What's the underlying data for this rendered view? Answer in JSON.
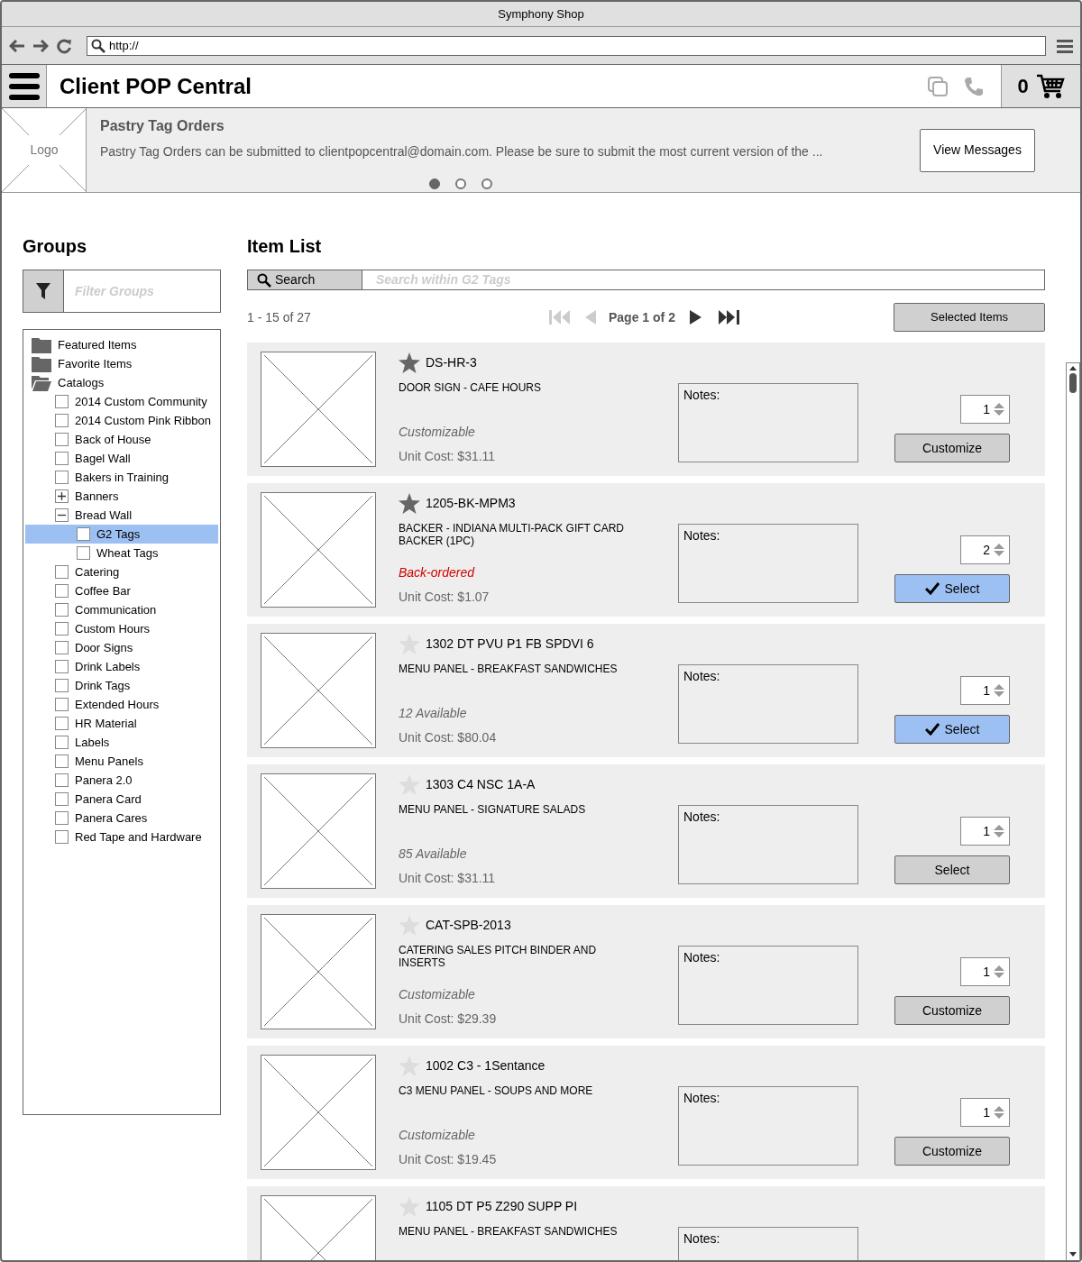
{
  "window": {
    "title": "Symphony Shop"
  },
  "browser": {
    "address": "http://"
  },
  "header": {
    "title": "Client POP Central",
    "cart_count": "0"
  },
  "banner": {
    "logo": "Logo",
    "title": "Pastry Tag Orders",
    "message": "Pastry Tag Orders can be submitted to clientpopcentral@domain.com. Please be sure to submit the most current version of the ...",
    "button": "View Messages",
    "dots": [
      {
        "selected": true
      },
      {
        "selected": false
      },
      {
        "selected": false
      }
    ]
  },
  "groups": {
    "title": "Groups",
    "filter_placeholder": "Filter Groups",
    "tree": [
      {
        "kind": "folder",
        "label": "Featured Items",
        "selected": false
      },
      {
        "kind": "folder",
        "label": "Favorite Items",
        "selected": false
      },
      {
        "kind": "open-folder",
        "label": "Catalogs",
        "selected": false,
        "children": [
          {
            "kind": "checkbox",
            "label": "2014 Custom Community",
            "selected": false
          },
          {
            "kind": "checkbox",
            "label": "2014 Custom Pink Ribbon",
            "selected": false
          },
          {
            "kind": "checkbox",
            "label": "Back of House",
            "selected": false
          },
          {
            "kind": "checkbox",
            "label": "Bagel Wall",
            "selected": false
          },
          {
            "kind": "checkbox",
            "label": "Bakers in Training",
            "selected": false
          },
          {
            "kind": "expander",
            "expanded": false,
            "label": "Banners",
            "selected": false
          },
          {
            "kind": "expander",
            "expanded": true,
            "label": "Bread Wall",
            "selected": false,
            "children": [
              {
                "kind": "checkbox",
                "label": "G2 Tags",
                "selected": true
              },
              {
                "kind": "checkbox",
                "label": "Wheat Tags",
                "selected": false
              }
            ]
          },
          {
            "kind": "checkbox",
            "label": "Catering",
            "selected": false
          },
          {
            "kind": "checkbox",
            "label": "Coffee Bar",
            "selected": false
          },
          {
            "kind": "checkbox",
            "label": "Communication",
            "selected": false
          },
          {
            "kind": "checkbox",
            "label": "Custom Hours",
            "selected": false
          },
          {
            "kind": "checkbox",
            "label": "Door Signs",
            "selected": false
          },
          {
            "kind": "checkbox",
            "label": "Drink Labels",
            "selected": false
          },
          {
            "kind": "checkbox",
            "label": "Drink Tags",
            "selected": false
          },
          {
            "kind": "checkbox",
            "label": "Extended Hours",
            "selected": false
          },
          {
            "kind": "checkbox",
            "label": "HR Material",
            "selected": false
          },
          {
            "kind": "checkbox",
            "label": "Labels",
            "selected": false
          },
          {
            "kind": "checkbox",
            "label": "Menu Panels",
            "selected": false
          },
          {
            "kind": "checkbox",
            "label": "Panera 2.0",
            "selected": false
          },
          {
            "kind": "checkbox",
            "label": "Panera Card",
            "selected": false
          },
          {
            "kind": "checkbox",
            "label": "Panera Cares",
            "selected": false
          },
          {
            "kind": "checkbox",
            "label": "Red Tape and Hardware",
            "selected": false
          }
        ]
      }
    ]
  },
  "item_list": {
    "title": "Item List",
    "search_button": "Search",
    "search_placeholder": "Search within G2 Tags",
    "range": "1 - 15 of 27",
    "page": "Page 1 of 2",
    "selected_items_button": "Selected Items",
    "items": [
      {
        "code": "DS-HR-3",
        "starred": true,
        "description": "DOOR SIGN - CAFE HOURS",
        "back_ordered": false,
        "status": "Customizable",
        "cost": "Unit Cost: $31.11",
        "notes_label": "Notes:",
        "quantity": "1",
        "action": "Customize",
        "selected": false
      },
      {
        "code": "1205-BK-MPM3",
        "starred": true,
        "description": "BACKER - INDIANA MULTI-PACK GIFT CARD BACKER (1PC)",
        "back_ordered": true,
        "status": "Back-ordered",
        "cost": "Unit Cost: $1.07",
        "notes_label": "Notes:",
        "quantity": "2",
        "action": "Select",
        "selected": true
      },
      {
        "code": "1302 DT PVU P1 FB SPDVI 6",
        "starred": false,
        "description": "MENU PANEL - BREAKFAST SANDWICHES",
        "back_ordered": false,
        "status": "12 Available",
        "cost": "Unit Cost: $80.04",
        "notes_label": "Notes:",
        "quantity": "1",
        "action": "Select",
        "selected": true
      },
      {
        "code": "1303 C4 NSC 1A-A",
        "starred": false,
        "description": "MENU PANEL - SIGNATURE SALADS",
        "back_ordered": false,
        "status": "85 Available",
        "cost": "Unit Cost: $31.11",
        "notes_label": "Notes:",
        "quantity": "1",
        "action": "Select",
        "selected": false
      },
      {
        "code": "CAT-SPB-2013",
        "starred": false,
        "description": "CATERING SALES PITCH BINDER AND INSERTS",
        "back_ordered": false,
        "status": "Customizable",
        "cost": "Unit Cost: $29.39",
        "notes_label": "Notes:",
        "quantity": "1",
        "action": "Customize",
        "selected": false
      },
      {
        "code": "1002 C3 - 1Sentance",
        "starred": false,
        "description": "C3 MENU PANEL - SOUPS AND MORE",
        "back_ordered": false,
        "status": "Customizable",
        "cost": "Unit Cost: $19.45",
        "notes_label": "Notes:",
        "quantity": "1",
        "action": "Customize",
        "selected": false
      },
      {
        "code": "1105 DT P5 Z290 SUPP PI",
        "starred": false,
        "description": "MENU PANEL - BREAKFAST SANDWICHES",
        "notes_label": "Notes:"
      }
    ]
  }
}
